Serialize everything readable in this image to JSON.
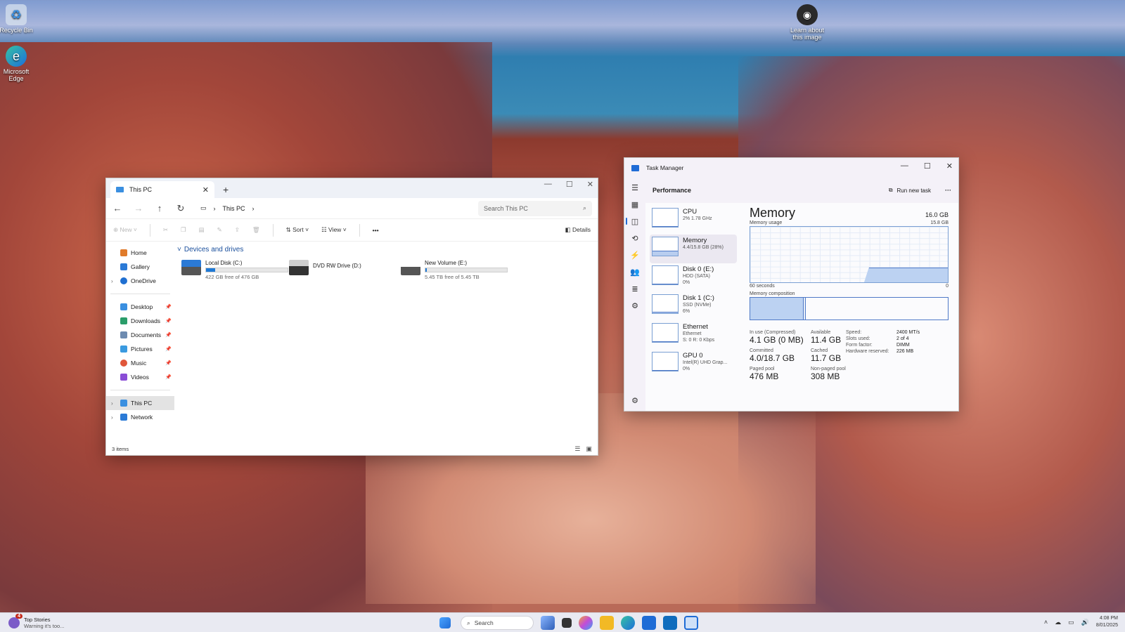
{
  "desktop": {
    "icons": [
      {
        "label": "Recycle Bin",
        "icon": "recycle-bin-icon"
      },
      {
        "label": "Microsoft Edge",
        "icon": "edge-icon"
      },
      {
        "label": "Learn about this image",
        "icon": "camera-info-icon"
      }
    ]
  },
  "explorer": {
    "tab_title": "This PC",
    "address": [
      "This PC"
    ],
    "search_placeholder": "Search This PC",
    "commands": {
      "new": "New",
      "sort": "Sort",
      "view": "View",
      "details": "Details"
    },
    "sidebar": [
      {
        "label": "Home",
        "color": "#e07b2b"
      },
      {
        "label": "Gallery",
        "color": "#2b7ad6"
      },
      {
        "label": "OneDrive",
        "color": "#1f6fd1"
      },
      {
        "label": "Desktop",
        "color": "#3a8fe0"
      },
      {
        "label": "Downloads",
        "color": "#2a9d6a"
      },
      {
        "label": "Documents",
        "color": "#6d8bb0"
      },
      {
        "label": "Pictures",
        "color": "#3a9ae0"
      },
      {
        "label": "Music",
        "color": "#e0563a"
      },
      {
        "label": "Videos",
        "color": "#8a4dd6"
      },
      {
        "label": "This PC",
        "color": "#3a8fe0"
      },
      {
        "label": "Network",
        "color": "#2b7ad6"
      }
    ],
    "group_label": "Devices and drives",
    "drives": [
      {
        "name": "Local Disk (C:)",
        "free": "422 GB free of 476 GB",
        "used_fraction": 0.11,
        "bar": true
      },
      {
        "name": "DVD RW Drive (D:)",
        "free": "",
        "used_fraction": 0,
        "bar": false
      },
      {
        "name": "New Volume (E:)",
        "free": "5.45 TB free of 5.45 TB",
        "used_fraction": 0.002,
        "bar": true
      }
    ],
    "status": "3 items"
  },
  "taskmanager": {
    "title": "Task Manager",
    "section": "Performance",
    "run_task": "Run new task",
    "items": [
      {
        "name": "CPU",
        "sub1": "2% 1.78 GHz",
        "sub2": "",
        "level": 0.05
      },
      {
        "name": "Memory",
        "sub1": "4.4/15.8 GB (28%)",
        "sub2": "",
        "level": 0.28
      },
      {
        "name": "Disk 0 (E:)",
        "sub1": "HDD (SATA)",
        "sub2": "0%",
        "level": 0
      },
      {
        "name": "Disk 1 (C:)",
        "sub1": "SSD (NVMe)",
        "sub2": "6%",
        "level": 0.06
      },
      {
        "name": "Ethernet",
        "sub1": "Ethernet",
        "sub2": "S: 0 R: 0 Kbps",
        "level": 0
      },
      {
        "name": "GPU 0",
        "sub1": "Intel(R) UHD Grap...",
        "sub2": "0%",
        "level": 0
      }
    ],
    "detail": {
      "title": "Memory",
      "total": "16.0 GB",
      "usage_label": "Memory usage",
      "usage_max": "15.8 GB",
      "axis_left": "60 seconds",
      "axis_right": "0",
      "composition_label": "Memory composition",
      "in_use_label": "In use (Compressed)",
      "in_use": "4.1 GB (0 MB)",
      "available_label": "Available",
      "available": "11.4 GB",
      "committed_label": "Committed",
      "committed": "4.0/18.7 GB",
      "cached_label": "Cached",
      "cached": "11.7 GB",
      "paged_label": "Paged pool",
      "paged": "476 MB",
      "nonpaged_label": "Non-paged pool",
      "nonpaged": "308 MB",
      "spec": [
        {
          "k": "Speed:",
          "v": "2400 MT/s"
        },
        {
          "k": "Slots used:",
          "v": "2 of 4"
        },
        {
          "k": "Form factor:",
          "v": "DIMM"
        },
        {
          "k": "Hardware reserved:",
          "v": "226 MB"
        }
      ]
    }
  },
  "taskbar": {
    "news_title": "Top Stories",
    "news_sub": "Warning it's too...",
    "news_count": "4",
    "search": "Search",
    "time": "4:08 PM",
    "date": "8/01/2025"
  }
}
